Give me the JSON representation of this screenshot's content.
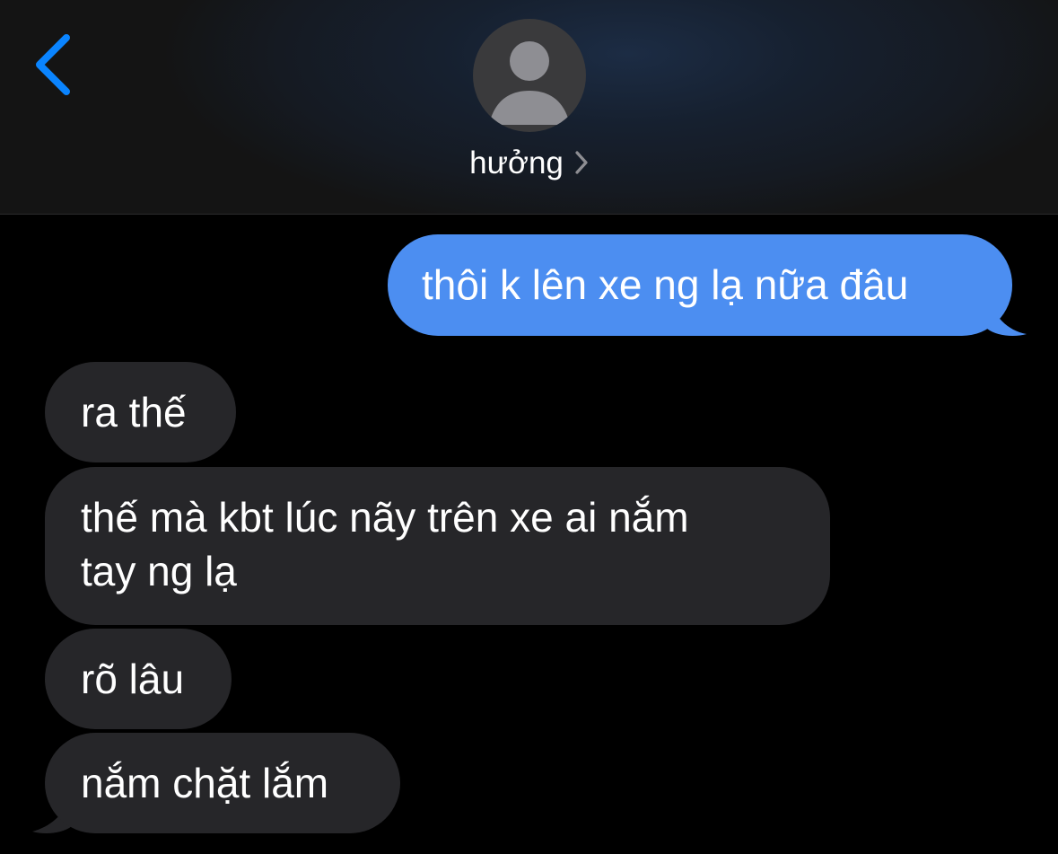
{
  "header": {
    "back_label": "",
    "contact_name": "hưởng"
  },
  "colors": {
    "sent_bubble": "#4c8ef1",
    "received_bubble": "#262629",
    "accent": "#0a84ff",
    "background": "#000000"
  },
  "icons": {
    "back": "chevron-left-icon",
    "avatar": "person-silhouette-icon",
    "contact_details": "chevron-right-icon"
  },
  "messages": [
    {
      "direction": "sent",
      "text": "thôi k lên xe ng lạ nữa đâu"
    },
    {
      "direction": "received",
      "text": "ra thế"
    },
    {
      "direction": "received",
      "lines": [
        "thế mà kbt lúc nãy trên xe ai nắm",
        "tay ng lạ"
      ]
    },
    {
      "direction": "received",
      "text": "rõ lâu"
    },
    {
      "direction": "received",
      "text": "nắm chặt lắm"
    }
  ]
}
